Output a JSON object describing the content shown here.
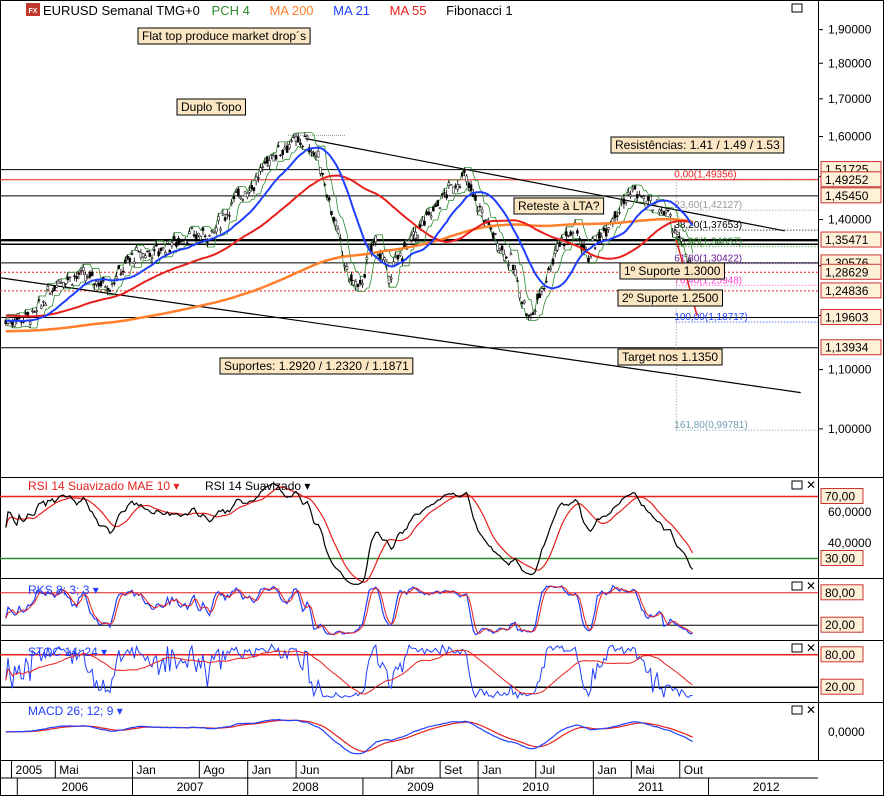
{
  "header": {
    "app_badge": "FX",
    "symbol": "EURUSD Semanal TMG+0",
    "ind1": "PCH 4",
    "ind2": "MA 200",
    "ind3": "MA 21",
    "ind4": "MA 55",
    "ind5": "Fibonacci 1"
  },
  "colors": {
    "background": "#ffffff",
    "candle": "#000000",
    "ma200": "#ff7f2a",
    "ma21": "#1f3fff",
    "ma55": "#e8201c",
    "pch": "#2e8b2e",
    "price_box_bg": "#fff0d8",
    "price_box_border": "#cc3333",
    "annotation_bg": "#fbe7c4",
    "down_trend": "#e8201c"
  },
  "annotations": {
    "flat_top": "Flat top produce market drop´s",
    "duplo_topo": "Duplo Topo",
    "resistencias": "Resistências: 1.41 / 1.49 / 1.53",
    "reteste": "Reteste à LTA?",
    "suporte1": "1º Suporte 1.3000",
    "suporte2": "2º Suporte 1.2500",
    "suportes": "Suportes: 1.2920 / 1.2320 / 1.1871",
    "target": "Target nos 1.1350"
  },
  "chart_data": [
    {
      "type": "line",
      "name": "EURUSD weekly price panel",
      "y_scale": "log",
      "ylim": [
        0.93,
        1.98
      ],
      "y_ticks": [
        "1,90000",
        "1,80000",
        "1,70000",
        "1,60000",
        "1,50000",
        "1,40000",
        "1,30000",
        "1,20000",
        "1,10000",
        "1,00000"
      ],
      "y_tick_values": [
        1.9,
        1.8,
        1.7,
        1.6,
        1.5,
        1.4,
        1.3,
        1.2,
        1.1,
        1.0
      ],
      "price_levels": [
        "1,51725",
        "1,49252",
        "1,45450",
        "1,35471",
        "1,30576",
        "1,28629",
        "1,24836",
        "1,19603",
        "1,13934"
      ],
      "price_level_values": [
        1.51725,
        1.49252,
        1.4545,
        1.35471,
        1.30576,
        1.28629,
        1.24836,
        1.19603,
        1.13934
      ],
      "fibonacci": [
        {
          "label": "0,00(1,49356)",
          "value": 1.49356
        },
        {
          "label": "23,60(1,42127)",
          "value": 1.42127
        },
        {
          "label": "38,20(1,37653)",
          "value": 1.37653
        },
        {
          "label": "50,00(1,34037)",
          "value": 1.34037
        },
        {
          "label": "61,80(1,30422)",
          "value": 1.30422
        },
        {
          "label": "76,40(1,25948)",
          "value": 1.25948
        },
        {
          "label": "100,00(1,18717)",
          "value": 1.18717
        },
        {
          "label": "161,80(0,99781)",
          "value": 0.99781
        }
      ],
      "price_anchor_points": [
        [
          2005.9,
          1.19
        ],
        [
          2006.15,
          1.2
        ],
        [
          2006.35,
          1.27
        ],
        [
          2006.55,
          1.28
        ],
        [
          2006.8,
          1.26
        ],
        [
          2007.0,
          1.32
        ],
        [
          2007.2,
          1.33
        ],
        [
          2007.45,
          1.36
        ],
        [
          2007.7,
          1.37
        ],
        [
          2007.9,
          1.45
        ],
        [
          2008.05,
          1.48
        ],
        [
          2008.2,
          1.55
        ],
        [
          2008.35,
          1.58
        ],
        [
          2008.5,
          1.59
        ],
        [
          2008.62,
          1.54
        ],
        [
          2008.75,
          1.4
        ],
        [
          2008.87,
          1.28
        ],
        [
          2008.97,
          1.25
        ],
        [
          2009.1,
          1.36
        ],
        [
          2009.22,
          1.28
        ],
        [
          2009.35,
          1.33
        ],
        [
          2009.55,
          1.4
        ],
        [
          2009.75,
          1.47
        ],
        [
          2009.88,
          1.5
        ],
        [
          2010.0,
          1.43
        ],
        [
          2010.15,
          1.36
        ],
        [
          2010.3,
          1.3
        ],
        [
          2010.4,
          1.22
        ],
        [
          2010.45,
          1.19
        ],
        [
          2010.55,
          1.25
        ],
        [
          2010.7,
          1.35
        ],
        [
          2010.85,
          1.38
        ],
        [
          2010.95,
          1.32
        ],
        [
          2011.05,
          1.36
        ],
        [
          2011.2,
          1.42
        ],
        [
          2011.35,
          1.47
        ],
        [
          2011.45,
          1.44
        ],
        [
          2011.55,
          1.43
        ],
        [
          2011.65,
          1.41
        ],
        [
          2011.72,
          1.37
        ],
        [
          2011.8,
          1.33
        ],
        [
          2011.88,
          1.27
        ]
      ]
    },
    {
      "type": "line",
      "name": "RSI panel",
      "series_labels": [
        "RSI 14 Suavizado MAE 10",
        "RSI 14 Suavizado"
      ],
      "y_ticks": [
        "60,0000",
        "40,0000"
      ],
      "y_tick_values": [
        60,
        40
      ],
      "levels": [
        "70,00",
        "30,00"
      ],
      "level_values": [
        70,
        30
      ]
    },
    {
      "type": "line",
      "name": "Stochastic RKS panel",
      "series_labels": [
        "RKS 8; 3; 3"
      ],
      "levels": [
        "80,00",
        "20,00"
      ],
      "level_values": [
        80,
        20
      ]
    },
    {
      "type": "line",
      "name": "Stochastic STOC panel",
      "series_labels": [
        "STOC 14; 24"
      ],
      "levels": [
        "80,00",
        "20,00"
      ],
      "level_values": [
        80,
        20
      ]
    },
    {
      "type": "line",
      "name": "MACD panel",
      "series_labels": [
        "MACD 26; 12; 9"
      ],
      "y_ticks": [
        "0,0000"
      ],
      "y_tick_values": [
        0
      ]
    }
  ],
  "x_axis": {
    "months": [
      {
        "label": "2005",
        "t": 2005.95
      },
      {
        "label": "Mai",
        "t": 2006.33
      },
      {
        "label": "Jan",
        "t": 2007.0
      },
      {
        "label": "Ago",
        "t": 2007.58
      },
      {
        "label": "Jan",
        "t": 2008.0
      },
      {
        "label": "Jun",
        "t": 2008.42
      },
      {
        "label": "Abr",
        "t": 2009.25
      },
      {
        "label": "Set",
        "t": 2009.67
      },
      {
        "label": "Jan",
        "t": 2010.0
      },
      {
        "label": "Jul",
        "t": 2010.5
      },
      {
        "label": "Jan",
        "t": 2011.0
      },
      {
        "label": "Mai",
        "t": 2011.33
      },
      {
        "label": "Out",
        "t": 2011.75
      }
    ],
    "years": [
      {
        "label": "2006",
        "t": 2006.5
      },
      {
        "label": "2007",
        "t": 2007.5
      },
      {
        "label": "2008",
        "t": 2008.5
      },
      {
        "label": "2009",
        "t": 2009.5
      },
      {
        "label": "2010",
        "t": 2010.5
      },
      {
        "label": "2011",
        "t": 2011.5
      },
      {
        "label": "2012",
        "t": 2012.5
      }
    ]
  }
}
